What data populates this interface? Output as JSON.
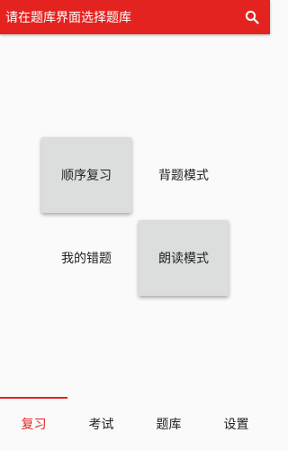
{
  "appbar": {
    "title": "请在题库界面选择题库",
    "search_icon": "search-icon"
  },
  "tiles": {
    "sequential_review": "顺序复习",
    "memorize_mode": "背题模式",
    "my_mistakes": "我的错题",
    "read_aloud_mode": "朗读模式"
  },
  "tabs": [
    {
      "label": "复习",
      "active": true
    },
    {
      "label": "考试",
      "active": false
    },
    {
      "label": "题库",
      "active": false
    },
    {
      "label": "设置",
      "active": false
    }
  ],
  "colors": {
    "accent": "#e42320",
    "tile": "#dcdddd",
    "background": "#fafafa"
  }
}
